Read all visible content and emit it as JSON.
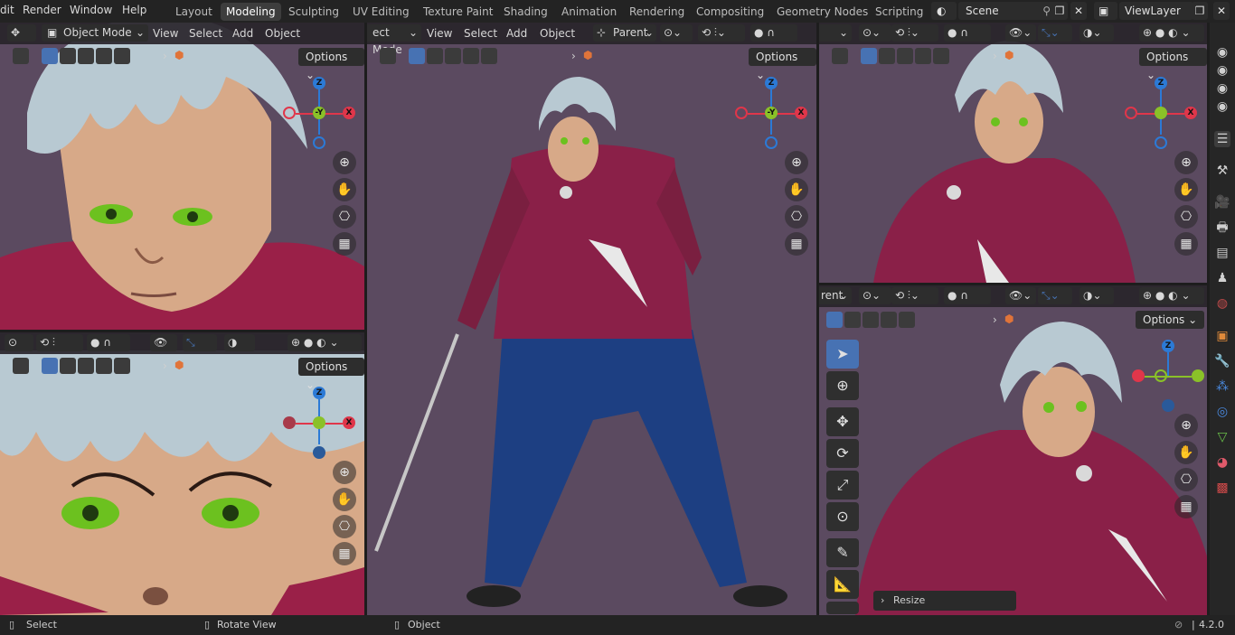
{
  "topbar": {
    "menu": [
      "dit",
      "Render",
      "Window",
      "Help"
    ],
    "workspaces": [
      "Layout",
      "Modeling",
      "Sculpting",
      "UV Editing",
      "Texture Paint",
      "Shading",
      "Animation",
      "Rendering",
      "Compositing",
      "Geometry Nodes",
      "Scripting"
    ],
    "active_workspace": "Modeling",
    "scene_name": "Scene",
    "view_layer": "ViewLayer"
  },
  "viewport_header": {
    "mode": "Object Mode",
    "mode_cut": "ect Mode",
    "view": "View",
    "select": "Select",
    "add": "Add",
    "object": "Object",
    "pivot": "Parent",
    "pivot_cut1": "Parent",
    "pivot_cut2": "rent",
    "options": "Options"
  },
  "gizmo": {
    "z": "Z",
    "y": "Y",
    "x": "X",
    "neg_y": "-Y"
  },
  "toolbar": {
    "resize": "Resize"
  },
  "statusbar": {
    "select": "Select",
    "rotate": "Rotate View",
    "object": "Object",
    "version": "4.2.0"
  },
  "colors": {
    "accent": "#4772b3",
    "viewport_bg": "#5a4a5e",
    "axis_x": "#e0364a",
    "axis_y": "#8ac128",
    "axis_z": "#2c7ad6"
  }
}
